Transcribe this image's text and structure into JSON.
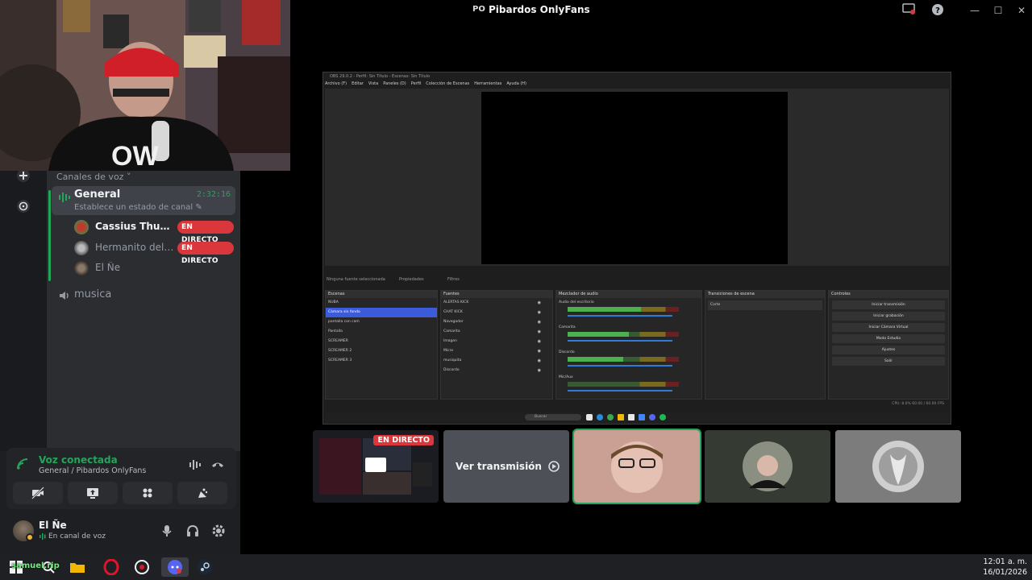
{
  "window": {
    "title": "Pibardos OnlyFans",
    "server_badge": "PO"
  },
  "channels": {
    "section_label": "Canales de voz",
    "general": {
      "name": "General",
      "timer": "2:32:16",
      "status": "Establece un estado de canal"
    },
    "members": [
      {
        "name": "Cassius Thunderc...",
        "live": "EN DIRECTO",
        "muted": false
      },
      {
        "name": "Hermanito del do...",
        "live": "EN DIRECTO",
        "muted": true
      },
      {
        "name": "El Ñe",
        "live": "",
        "muted": true
      }
    ],
    "music": {
      "name": "musica"
    }
  },
  "voice_panel": {
    "title": "Voz conectada",
    "subtitle": "General / Pibardos OnlyFans"
  },
  "user_panel": {
    "name": "El Ñe",
    "status": "En canal de voz"
  },
  "obs": {
    "title": "OBS 29.0.2 - Perfil: Sin Título - Escenas: Sin Título",
    "menu": [
      "Archivo (F)",
      "Editar",
      "Vista",
      "Paneles (D)",
      "Perfil",
      "Colección de Escenas",
      "Herramientas",
      "Ayuda (H)"
    ],
    "no_source": "Ninguna fuente seleccionada",
    "properties": "Propiedades",
    "filters": "Filtros",
    "docks": {
      "scenes": "Escenas",
      "sources": "Fuentes",
      "mixer": "Mezclador de audio",
      "transitions": "Transiciones de escena",
      "controls": "Controles"
    },
    "scenes": [
      "NUBA",
      "Cámara sin fondo",
      "pantalla con cam",
      "Pantalla",
      "SCREAMER",
      "SCREAMER 2",
      "SCREAMER 3"
    ],
    "selected_scene": 1,
    "sources": [
      "ALERTAS KICK",
      "CHAT KICK",
      "Navegador",
      "Camarita",
      "Imagen",
      "Micro",
      "musiquita",
      "Discordo"
    ],
    "mixer_channels": [
      "Audio del escritorio",
      "Camarita",
      "Discordo",
      "Mic/Aux"
    ],
    "transition": "Corte",
    "controls": [
      "Iniciar transmisión",
      "Iniciar grabación",
      "Iniciar Cámara Virtual",
      "Modo Estudio",
      "Ajustes",
      "Salir"
    ],
    "status": "CPU: 8.0%   60.00 / 60.00 FPS",
    "search_label": "Buscar"
  },
  "tiles": [
    {
      "kind": "stream",
      "live": "EN DIRECTO"
    },
    {
      "kind": "watch",
      "label": "Ver transmisión"
    },
    {
      "kind": "camera",
      "speaking": true
    },
    {
      "kind": "avatar"
    },
    {
      "kind": "avatar"
    }
  ],
  "taskbar": {
    "time": "12:01 a. m.",
    "date": "16/01/2026",
    "user": "samuel.rip"
  },
  "colors": {
    "online_green": "#23a55a",
    "live_red": "#da373c",
    "bg": "#1e1f22"
  }
}
